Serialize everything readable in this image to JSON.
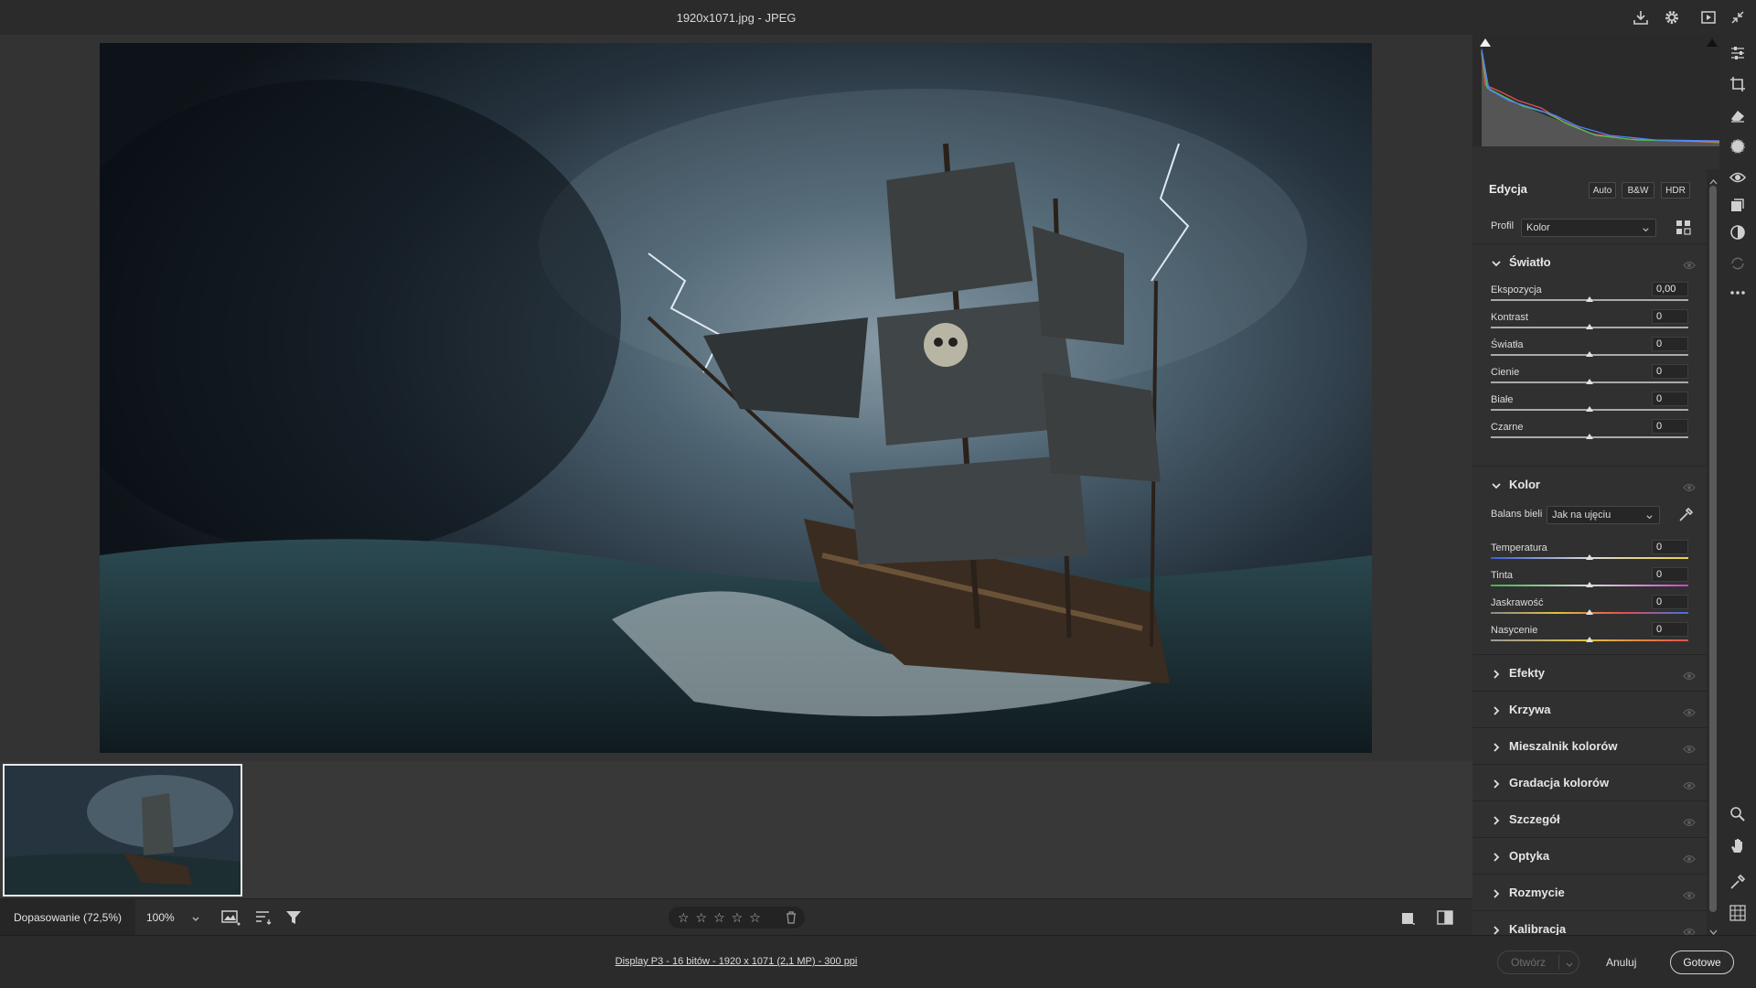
{
  "window": {
    "title": "1920x1071.jpg  -  JPEG"
  },
  "edit": {
    "title": "Edycja",
    "buttons": {
      "auto": "Auto",
      "bw": "B&W",
      "hdr": "HDR"
    },
    "profile_label": "Profil",
    "profile_value": "Kolor"
  },
  "light": {
    "title": "Światło",
    "sliders": [
      {
        "label": "Ekspozycja",
        "value": "0,00"
      },
      {
        "label": "Kontrast",
        "value": "0"
      },
      {
        "label": "Światła",
        "value": "0"
      },
      {
        "label": "Cienie",
        "value": "0"
      },
      {
        "label": "Białe",
        "value": "0"
      },
      {
        "label": "Czarne",
        "value": "0"
      }
    ]
  },
  "color": {
    "title": "Kolor",
    "wb_label": "Balans bieli",
    "wb_value": "Jak na ujęciu",
    "sliders": [
      {
        "label": "Temperatura",
        "value": "0"
      },
      {
        "label": "Tinta",
        "value": "0"
      },
      {
        "label": "Jaskrawość",
        "value": "0"
      },
      {
        "label": "Nasycenie",
        "value": "0"
      }
    ]
  },
  "collapsed_sections": [
    "Efekty",
    "Krzywa",
    "Mieszalnik kolorów",
    "Gradacja kolorów",
    "Szczegół",
    "Optyka",
    "Rozmycie",
    "Kalibracja"
  ],
  "bottombar": {
    "fit": "Dopasowanie (72,5%)",
    "zoom": "100%"
  },
  "footer": {
    "info": "Display P3 - 16 bitów - 1920 x 1071 (2,1 MP) - 300 ppi",
    "open": "Otwórz",
    "cancel": "Anuluj",
    "done": "Gotowe"
  },
  "rating": {
    "stars": 0,
    "max": 5
  }
}
